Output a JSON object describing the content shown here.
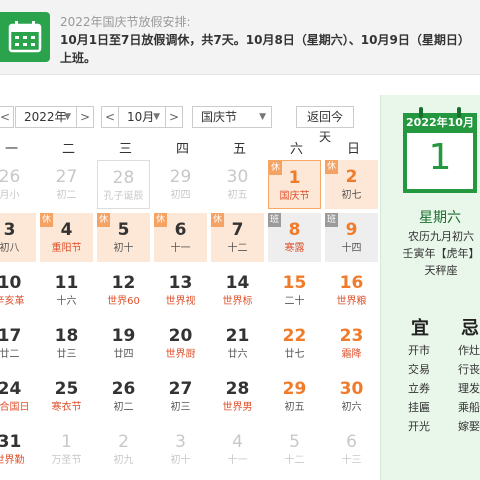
{
  "notice": {
    "icon": "calendar-icon",
    "title": "2022年国庆节放假安排:",
    "text": "10月1日至7日放假调休，共7天。10月8日（星期六）、10月9日（星期日）上班。"
  },
  "toolbar": {
    "prev": "<",
    "year": "2022年",
    "next": ">",
    "month_prev": "<",
    "month": "10月",
    "month_next": ">",
    "holiday": "国庆节",
    "today_button": "返回今天"
  },
  "weekdays": [
    "一",
    "二",
    "三",
    "四",
    "五",
    "六",
    "日"
  ],
  "weeks": [
    [
      {
        "day": "26",
        "lunar": "月小",
        "other": true
      },
      {
        "day": "27",
        "lunar": "初二",
        "other": true
      },
      {
        "day": "28",
        "lunar": "孔子诞辰",
        "other": true,
        "today": true
      },
      {
        "day": "29",
        "lunar": "初四",
        "other": true
      },
      {
        "day": "30",
        "lunar": "初五",
        "other": true
      },
      {
        "day": "1",
        "lunar": "国庆节",
        "tag": "休",
        "holiday": true,
        "selected": true,
        "weekend": true,
        "fest": true
      },
      {
        "day": "2",
        "lunar": "初七",
        "tag": "休",
        "holiday": true,
        "weekend": true
      }
    ],
    [
      {
        "day": "3",
        "lunar": "初八",
        "tag": "休",
        "holiday": true
      },
      {
        "day": "4",
        "lunar": "重阳节",
        "tag": "休",
        "holiday": true,
        "fest": true
      },
      {
        "day": "5",
        "lunar": "初十",
        "tag": "休",
        "holiday": true
      },
      {
        "day": "6",
        "lunar": "十一",
        "tag": "休",
        "holiday": true
      },
      {
        "day": "7",
        "lunar": "十二",
        "tag": "休",
        "holiday": true
      },
      {
        "day": "8",
        "lunar": "寒露",
        "tag": "班",
        "work": true,
        "weekend": true,
        "fest": true
      },
      {
        "day": "9",
        "lunar": "十四",
        "tag": "班",
        "work": true,
        "weekend": true
      }
    ],
    [
      {
        "day": "10",
        "lunar": "辛亥革",
        "fest": true
      },
      {
        "day": "11",
        "lunar": "十六"
      },
      {
        "day": "12",
        "lunar": "世界60",
        "fest": true
      },
      {
        "day": "13",
        "lunar": "世界视",
        "fest": true
      },
      {
        "day": "14",
        "lunar": "世界标",
        "fest": true
      },
      {
        "day": "15",
        "lunar": "二十",
        "weekend": true
      },
      {
        "day": "16",
        "lunar": "世界粮",
        "weekend": true,
        "fest": true
      }
    ],
    [
      {
        "day": "17",
        "lunar": "廿二"
      },
      {
        "day": "18",
        "lunar": "廿三"
      },
      {
        "day": "19",
        "lunar": "廿四"
      },
      {
        "day": "20",
        "lunar": "世界厨",
        "fest": true
      },
      {
        "day": "21",
        "lunar": "廿六"
      },
      {
        "day": "22",
        "lunar": "廿七",
        "weekend": true
      },
      {
        "day": "23",
        "lunar": "霜降",
        "weekend": true,
        "fest": true
      }
    ],
    [
      {
        "day": "24",
        "lunar": "联合国日",
        "fest": true
      },
      {
        "day": "25",
        "lunar": "寒衣节",
        "fest": true
      },
      {
        "day": "26",
        "lunar": "初二"
      },
      {
        "day": "27",
        "lunar": "初三"
      },
      {
        "day": "28",
        "lunar": "世界男",
        "fest": true
      },
      {
        "day": "29",
        "lunar": "初五",
        "weekend": true
      },
      {
        "day": "30",
        "lunar": "初六",
        "weekend": true
      }
    ],
    [
      {
        "day": "31",
        "lunar": "世界勤",
        "fest": true
      },
      {
        "day": "1",
        "lunar": "万圣节",
        "other": true
      },
      {
        "day": "2",
        "lunar": "初九",
        "other": true
      },
      {
        "day": "3",
        "lunar": "初十",
        "other": true
      },
      {
        "day": "4",
        "lunar": "十一",
        "other": true
      },
      {
        "day": "5",
        "lunar": "十二",
        "other": true,
        "weekend": true
      },
      {
        "day": "6",
        "lunar": "十三",
        "other": true,
        "weekend": true
      }
    ]
  ],
  "side": {
    "header": "2022年10月",
    "day": "1",
    "weekday": "星期六",
    "lunar": "农历九月初六",
    "ganzhi": "壬寅年【虎年】",
    "constellation": "天秤座",
    "yi_label": "宜",
    "ji_label": "忌",
    "yi": [
      "开市",
      "交易",
      "立券",
      "挂匾",
      "开光"
    ],
    "ji": [
      "作灶",
      "行丧",
      "理发",
      "乘船",
      "嫁娶"
    ]
  }
}
